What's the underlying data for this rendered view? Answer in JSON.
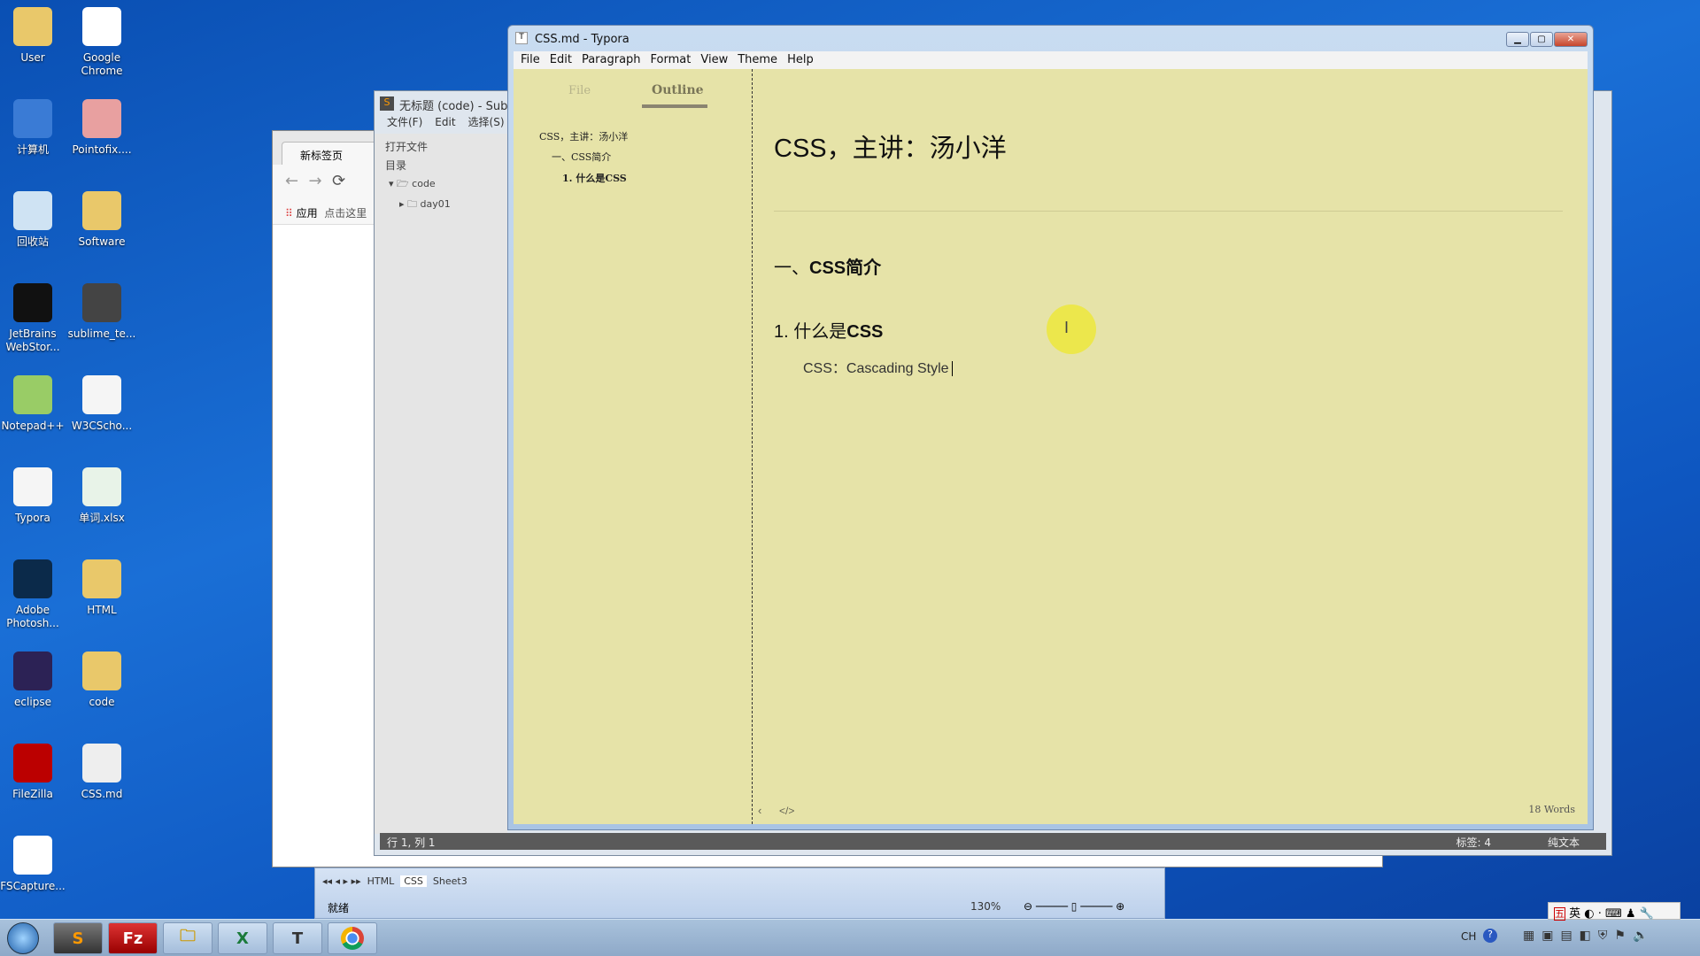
{
  "desktop_icons": [
    {
      "label": "User",
      "icon": "user-folder-icon"
    },
    {
      "label": "Google Chrome",
      "icon": "chrome-icon"
    },
    {
      "label": "计算机",
      "icon": "computer-icon"
    },
    {
      "label": "Pointofix....",
      "icon": "pointofix-icon"
    },
    {
      "label": "回收站",
      "icon": "recycle-bin-icon"
    },
    {
      "label": "Software",
      "icon": "folder-icon"
    },
    {
      "label": "JetBrains WebStor...",
      "icon": "webstorm-icon"
    },
    {
      "label": "sublime_te...",
      "icon": "sublime-icon"
    },
    {
      "label": "Notepad++",
      "icon": "notepadpp-icon"
    },
    {
      "label": "W3CScho...",
      "icon": "help-file-icon"
    },
    {
      "label": "Typora",
      "icon": "typora-icon"
    },
    {
      "label": "单词.xlsx",
      "icon": "excel-file-icon"
    },
    {
      "label": "Adobe Photosh...",
      "icon": "photoshop-icon"
    },
    {
      "label": "HTML",
      "icon": "folder-icon"
    },
    {
      "label": "eclipse",
      "icon": "eclipse-icon"
    },
    {
      "label": "code",
      "icon": "folder-icon"
    },
    {
      "label": "FileZilla",
      "icon": "filezilla-icon"
    },
    {
      "label": "CSS.md",
      "icon": "markdown-icon"
    },
    {
      "label": "FSCapture...",
      "icon": "fscapture-icon"
    }
  ],
  "chrome": {
    "tab": "新标签页",
    "apps": "应用",
    "bookmark": "点击这里"
  },
  "sublime": {
    "title": "无标题 (code) - Sublime Text",
    "menu": [
      "文件(F)",
      "Edit",
      "选择(S)"
    ],
    "sidebar": {
      "open_files": "打开文件",
      "folders": "目录",
      "tree": [
        "code",
        "day01"
      ]
    },
    "status": {
      "position": "行 1, 列 1",
      "tabs": "标签: 4",
      "syntax": "纯文本"
    }
  },
  "excel": {
    "sheets": [
      "HTML",
      "CSS",
      "Sheet3"
    ],
    "status": "就绪",
    "zoom": "130%"
  },
  "typora": {
    "title": "CSS.md - Typora",
    "menu": [
      "File",
      "Edit",
      "Paragraph",
      "Format",
      "View",
      "Theme",
      "Help"
    ],
    "sidebar_tabs": {
      "file": "File",
      "outline": "Outline",
      "active": "Outline"
    },
    "outline": [
      "CSS，主讲：汤小洋",
      "一、CSS简介",
      "1. 什么是CSS"
    ],
    "doc": {
      "h1": "CSS，主讲：汤小洋",
      "h2_prefix": "一、",
      "h2_bold": "CSS简介",
      "h3_num": "1.",
      "h3_text": "什么是",
      "h3_bold": "CSS",
      "p": "CSS：Cascading Style"
    },
    "word_count": "18 Words",
    "background": "#e6e3a8"
  },
  "tray": {
    "lang": "CH",
    "ime": [
      "五",
      "英"
    ]
  }
}
